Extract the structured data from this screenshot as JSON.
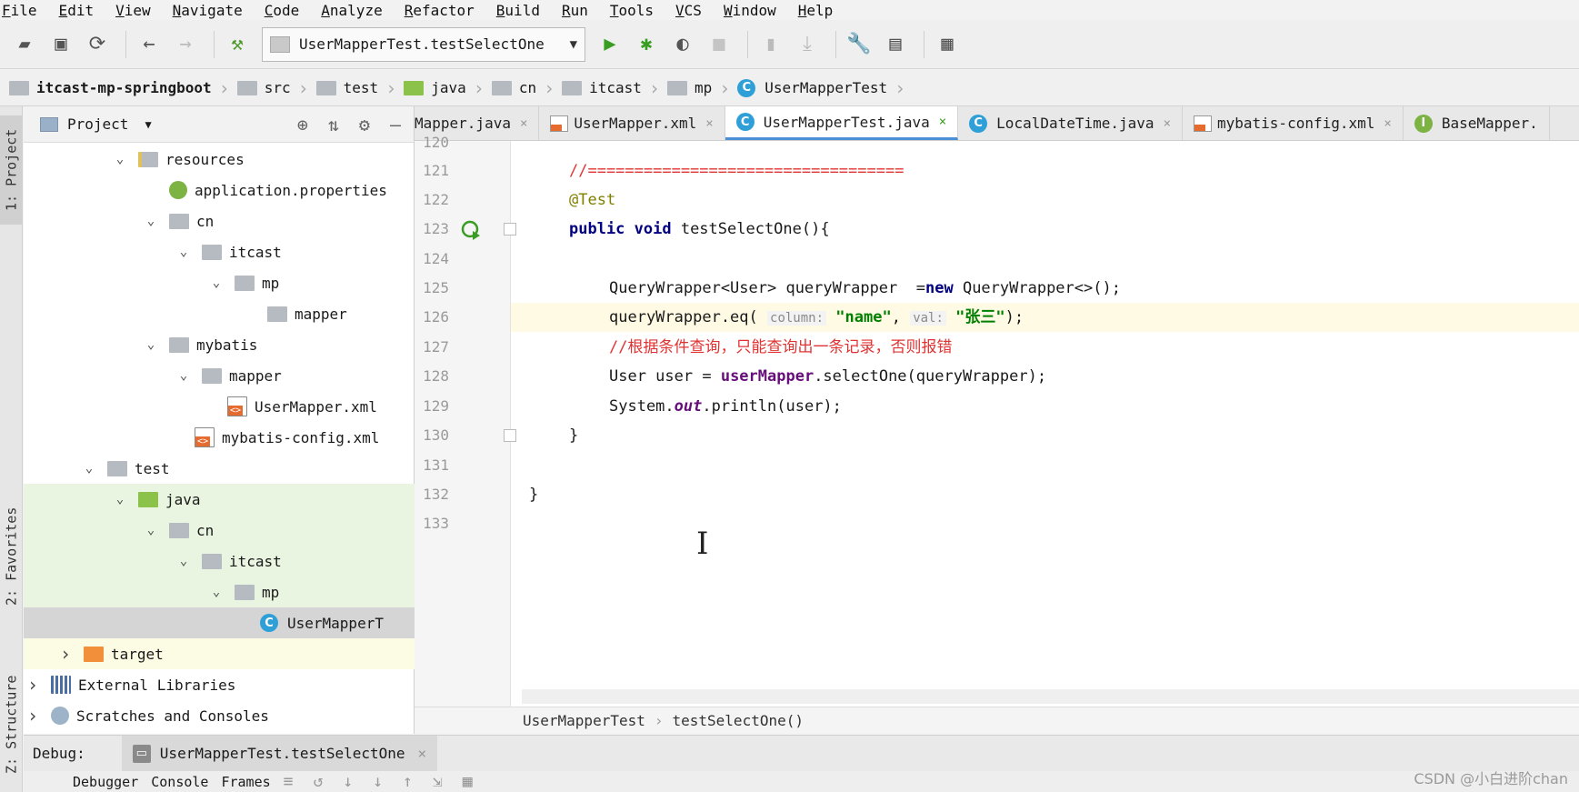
{
  "menu": [
    "File",
    "Edit",
    "View",
    "Navigate",
    "Code",
    "Analyze",
    "Refactor",
    "Build",
    "Run",
    "Tools",
    "VCS",
    "Window",
    "Help"
  ],
  "toolbar": {
    "run_config": "UserMapperTest.testSelectOne"
  },
  "breadcrumb": {
    "project": "itcast-mp-springboot",
    "parts": [
      "src",
      "test",
      "java",
      "cn",
      "itcast",
      "mp"
    ],
    "class": "UserMapperTest"
  },
  "left_strip": {
    "project_tab": "1: Project",
    "favorites_tab": "2: Favorites",
    "structure_tab": "Z: Structure"
  },
  "project_panel": {
    "title": "Project",
    "tree": [
      {
        "label": "resources",
        "arrow": "⌄"
      },
      {
        "label": "application.properties",
        "arrow": ""
      },
      {
        "label": "cn",
        "arrow": "⌄"
      },
      {
        "label": "itcast",
        "arrow": "⌄"
      },
      {
        "label": "mp",
        "arrow": "⌄"
      },
      {
        "label": "mapper",
        "arrow": ""
      },
      {
        "label": "mybatis",
        "arrow": "⌄"
      },
      {
        "label": "mapper",
        "arrow": "⌄"
      },
      {
        "label": "UserMapper.xml",
        "arrow": ""
      },
      {
        "label": "mybatis-config.xml",
        "arrow": ""
      },
      {
        "label": "test",
        "arrow": "⌄"
      },
      {
        "label": "java",
        "arrow": "⌄"
      },
      {
        "label": "cn",
        "arrow": "⌄"
      },
      {
        "label": "itcast",
        "arrow": "⌄"
      },
      {
        "label": "mp",
        "arrow": "⌄"
      },
      {
        "label": "UserMapperT",
        "arrow": ""
      },
      {
        "label": "target",
        "arrow": "›"
      },
      {
        "label": "External Libraries",
        "arrow": "›"
      },
      {
        "label": "Scratches and Consoles",
        "arrow": "›"
      }
    ]
  },
  "tabs": [
    {
      "label": "Mapper.java",
      "close": "×"
    },
    {
      "label": "UserMapper.xml",
      "close": "×"
    },
    {
      "label": "UserMapperTest.java",
      "close": "×"
    },
    {
      "label": "LocalDateTime.java",
      "close": "×"
    },
    {
      "label": "mybatis-config.xml",
      "close": "×"
    },
    {
      "label": "BaseMapper.",
      "close": ""
    }
  ],
  "editor": {
    "line_numbers": [
      "120",
      "121",
      "122",
      "123",
      "124",
      "125",
      "126",
      "127",
      "128",
      "129",
      "130",
      "131",
      "132",
      "133"
    ],
    "code": {
      "l121": "//==================================",
      "l122": "@Test",
      "l123_kw": "public void",
      "l123_rest": " testSelectOne(){",
      "l125_a": "QueryWrapper<User> queryWrapper  =",
      "l125_kw": "new",
      "l125_b": " QueryWrapper<>();",
      "l126_a": "queryWrapper.eq(",
      "l126_hint1": "column:",
      "l126_str1": "\"name\"",
      "l126_comma": ",",
      "l126_hint2": "val:",
      "l126_str2": "\"张三\"",
      "l126_end": ");",
      "l127": "//根据条件查询，只能查询出一条记录，否则报错",
      "l128_a": "User user = ",
      "l128_fld": "userMapper",
      "l128_b": ".selectOne(queryWrapper);",
      "l129_a": "System.",
      "l129_fld": "out",
      "l129_b": ".println(user);",
      "l130": "}",
      "l132": "}"
    }
  },
  "editor_breadcrumb": {
    "class": "UserMapperTest",
    "method": "testSelectOne()"
  },
  "debug": {
    "label": "Debug:",
    "session": "UserMapperTest.testSelectOne",
    "tabs": [
      "Debugger",
      "Console",
      "Frames"
    ]
  },
  "watermark": "CSDN @小白进阶chan"
}
